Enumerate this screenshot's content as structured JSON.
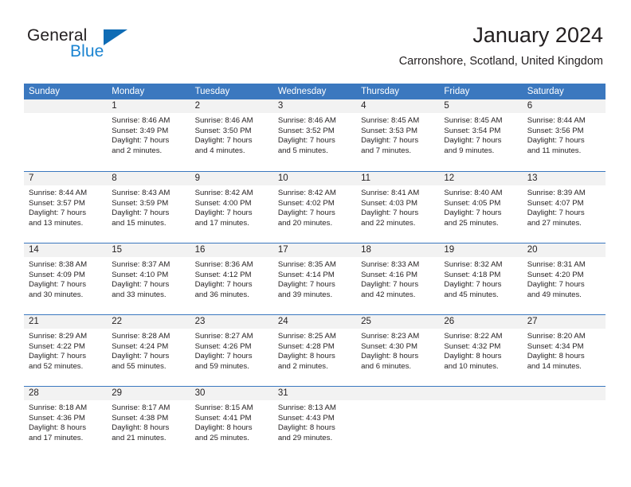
{
  "brand": {
    "name_part1": "General",
    "name_part2": "Blue",
    "accent_color": "#1b84d1",
    "logo_triangle_color": "#0f6cb5"
  },
  "header": {
    "title": "January 2024",
    "subtitle": "Carronshore, Scotland, United Kingdom"
  },
  "theme": {
    "header_row_bg": "#3b78bf",
    "header_row_text": "#ffffff",
    "day_number_bg": "#f2f2f2",
    "text_color": "#231f20"
  },
  "weekdays": [
    "Sunday",
    "Monday",
    "Tuesday",
    "Wednesday",
    "Thursday",
    "Friday",
    "Saturday"
  ],
  "weeks": [
    [
      {
        "day": "",
        "l1": "",
        "l2": "",
        "l3": "",
        "l4": ""
      },
      {
        "day": "1",
        "l1": "Sunrise: 8:46 AM",
        "l2": "Sunset: 3:49 PM",
        "l3": "Daylight: 7 hours",
        "l4": "and 2 minutes."
      },
      {
        "day": "2",
        "l1": "Sunrise: 8:46 AM",
        "l2": "Sunset: 3:50 PM",
        "l3": "Daylight: 7 hours",
        "l4": "and 4 minutes."
      },
      {
        "day": "3",
        "l1": "Sunrise: 8:46 AM",
        "l2": "Sunset: 3:52 PM",
        "l3": "Daylight: 7 hours",
        "l4": "and 5 minutes."
      },
      {
        "day": "4",
        "l1": "Sunrise: 8:45 AM",
        "l2": "Sunset: 3:53 PM",
        "l3": "Daylight: 7 hours",
        "l4": "and 7 minutes."
      },
      {
        "day": "5",
        "l1": "Sunrise: 8:45 AM",
        "l2": "Sunset: 3:54 PM",
        "l3": "Daylight: 7 hours",
        "l4": "and 9 minutes."
      },
      {
        "day": "6",
        "l1": "Sunrise: 8:44 AM",
        "l2": "Sunset: 3:56 PM",
        "l3": "Daylight: 7 hours",
        "l4": "and 11 minutes."
      }
    ],
    [
      {
        "day": "7",
        "l1": "Sunrise: 8:44 AM",
        "l2": "Sunset: 3:57 PM",
        "l3": "Daylight: 7 hours",
        "l4": "and 13 minutes."
      },
      {
        "day": "8",
        "l1": "Sunrise: 8:43 AM",
        "l2": "Sunset: 3:59 PM",
        "l3": "Daylight: 7 hours",
        "l4": "and 15 minutes."
      },
      {
        "day": "9",
        "l1": "Sunrise: 8:42 AM",
        "l2": "Sunset: 4:00 PM",
        "l3": "Daylight: 7 hours",
        "l4": "and 17 minutes."
      },
      {
        "day": "10",
        "l1": "Sunrise: 8:42 AM",
        "l2": "Sunset: 4:02 PM",
        "l3": "Daylight: 7 hours",
        "l4": "and 20 minutes."
      },
      {
        "day": "11",
        "l1": "Sunrise: 8:41 AM",
        "l2": "Sunset: 4:03 PM",
        "l3": "Daylight: 7 hours",
        "l4": "and 22 minutes."
      },
      {
        "day": "12",
        "l1": "Sunrise: 8:40 AM",
        "l2": "Sunset: 4:05 PM",
        "l3": "Daylight: 7 hours",
        "l4": "and 25 minutes."
      },
      {
        "day": "13",
        "l1": "Sunrise: 8:39 AM",
        "l2": "Sunset: 4:07 PM",
        "l3": "Daylight: 7 hours",
        "l4": "and 27 minutes."
      }
    ],
    [
      {
        "day": "14",
        "l1": "Sunrise: 8:38 AM",
        "l2": "Sunset: 4:09 PM",
        "l3": "Daylight: 7 hours",
        "l4": "and 30 minutes."
      },
      {
        "day": "15",
        "l1": "Sunrise: 8:37 AM",
        "l2": "Sunset: 4:10 PM",
        "l3": "Daylight: 7 hours",
        "l4": "and 33 minutes."
      },
      {
        "day": "16",
        "l1": "Sunrise: 8:36 AM",
        "l2": "Sunset: 4:12 PM",
        "l3": "Daylight: 7 hours",
        "l4": "and 36 minutes."
      },
      {
        "day": "17",
        "l1": "Sunrise: 8:35 AM",
        "l2": "Sunset: 4:14 PM",
        "l3": "Daylight: 7 hours",
        "l4": "and 39 minutes."
      },
      {
        "day": "18",
        "l1": "Sunrise: 8:33 AM",
        "l2": "Sunset: 4:16 PM",
        "l3": "Daylight: 7 hours",
        "l4": "and 42 minutes."
      },
      {
        "day": "19",
        "l1": "Sunrise: 8:32 AM",
        "l2": "Sunset: 4:18 PM",
        "l3": "Daylight: 7 hours",
        "l4": "and 45 minutes."
      },
      {
        "day": "20",
        "l1": "Sunrise: 8:31 AM",
        "l2": "Sunset: 4:20 PM",
        "l3": "Daylight: 7 hours",
        "l4": "and 49 minutes."
      }
    ],
    [
      {
        "day": "21",
        "l1": "Sunrise: 8:29 AM",
        "l2": "Sunset: 4:22 PM",
        "l3": "Daylight: 7 hours",
        "l4": "and 52 minutes."
      },
      {
        "day": "22",
        "l1": "Sunrise: 8:28 AM",
        "l2": "Sunset: 4:24 PM",
        "l3": "Daylight: 7 hours",
        "l4": "and 55 minutes."
      },
      {
        "day": "23",
        "l1": "Sunrise: 8:27 AM",
        "l2": "Sunset: 4:26 PM",
        "l3": "Daylight: 7 hours",
        "l4": "and 59 minutes."
      },
      {
        "day": "24",
        "l1": "Sunrise: 8:25 AM",
        "l2": "Sunset: 4:28 PM",
        "l3": "Daylight: 8 hours",
        "l4": "and 2 minutes."
      },
      {
        "day": "25",
        "l1": "Sunrise: 8:23 AM",
        "l2": "Sunset: 4:30 PM",
        "l3": "Daylight: 8 hours",
        "l4": "and 6 minutes."
      },
      {
        "day": "26",
        "l1": "Sunrise: 8:22 AM",
        "l2": "Sunset: 4:32 PM",
        "l3": "Daylight: 8 hours",
        "l4": "and 10 minutes."
      },
      {
        "day": "27",
        "l1": "Sunrise: 8:20 AM",
        "l2": "Sunset: 4:34 PM",
        "l3": "Daylight: 8 hours",
        "l4": "and 14 minutes."
      }
    ],
    [
      {
        "day": "28",
        "l1": "Sunrise: 8:18 AM",
        "l2": "Sunset: 4:36 PM",
        "l3": "Daylight: 8 hours",
        "l4": "and 17 minutes."
      },
      {
        "day": "29",
        "l1": "Sunrise: 8:17 AM",
        "l2": "Sunset: 4:38 PM",
        "l3": "Daylight: 8 hours",
        "l4": "and 21 minutes."
      },
      {
        "day": "30",
        "l1": "Sunrise: 8:15 AM",
        "l2": "Sunset: 4:41 PM",
        "l3": "Daylight: 8 hours",
        "l4": "and 25 minutes."
      },
      {
        "day": "31",
        "l1": "Sunrise: 8:13 AM",
        "l2": "Sunset: 4:43 PM",
        "l3": "Daylight: 8 hours",
        "l4": "and 29 minutes."
      },
      {
        "day": "",
        "l1": "",
        "l2": "",
        "l3": "",
        "l4": ""
      },
      {
        "day": "",
        "l1": "",
        "l2": "",
        "l3": "",
        "l4": ""
      },
      {
        "day": "",
        "l1": "",
        "l2": "",
        "l3": "",
        "l4": ""
      }
    ]
  ]
}
